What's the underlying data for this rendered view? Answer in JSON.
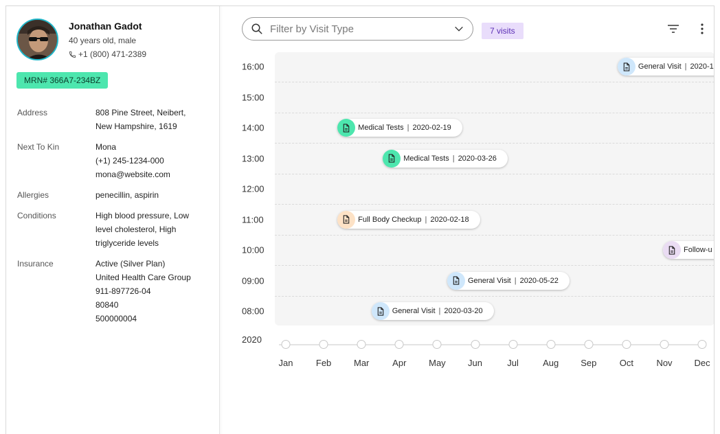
{
  "patient": {
    "name": "Jonathan Gadot",
    "age_sex": "40 years old, male",
    "phone": "+1 (800) 471-2389",
    "mrn": "MRN# 366A7-234BZ"
  },
  "details": [
    {
      "key": "Address",
      "lines": [
        "808 Pine Street, Neibert,",
        "New Hampshire, 1619"
      ]
    },
    {
      "key": "Next To Kin",
      "lines": [
        "Mona",
        "(+1) 245-1234-000",
        "mona@website.com"
      ]
    },
    {
      "key": "Allergies",
      "lines": [
        "penecillin, aspirin"
      ]
    },
    {
      "key": "Conditions",
      "lines": [
        "High blood pressure, Low",
        "level cholesterol, High",
        "triglyceride levels"
      ]
    },
    {
      "key": "Insurance",
      "lines": [
        "Active (Silver Plan)",
        "United Health Care Group",
        "911-897726-04",
        "80840",
        "500000004"
      ]
    }
  ],
  "toolbar": {
    "search_placeholder": "Filter by Visit Type",
    "visits_badge": "7 visits"
  },
  "colors": {
    "medical_tests": "#4de6ae",
    "full_body_checkup": "#fde2c6",
    "general_visit": "#cfe7fb",
    "follow_up": "#eadcf3"
  },
  "chart_data": {
    "type": "scatter",
    "year_label": "2020",
    "y_ticks": [
      "16:00",
      "15:00",
      "14:00",
      "13:00",
      "12:00",
      "11:00",
      "10:00",
      "09:00",
      "08:00"
    ],
    "x_ticks": [
      "Jan",
      "Feb",
      "Mar",
      "Apr",
      "May",
      "Jun",
      "Jul",
      "Aug",
      "Sep",
      "Oct",
      "Nov",
      "Dec"
    ],
    "ylim": [
      8,
      16
    ],
    "visits": [
      {
        "type": "General Visit",
        "date": "2020-1",
        "month": 10.0,
        "hour": 16.0,
        "label": "General Visit | 2020-1",
        "color_key": "general_visit"
      },
      {
        "type": "Medical Tests",
        "date": "2020-02-19",
        "month": 2.6,
        "hour": 14.0,
        "label": "Medical Tests | 2020-02-19",
        "color_key": "medical_tests"
      },
      {
        "type": "Medical Tests",
        "date": "2020-03-26",
        "month": 3.8,
        "hour": 13.0,
        "label": "Medical Tests | 2020-03-26",
        "color_key": "medical_tests"
      },
      {
        "type": "Full Body Checkup",
        "date": "2020-02-18",
        "month": 2.6,
        "hour": 11.0,
        "label": "Full Body Checkup | 2020-02-18",
        "color_key": "full_body_checkup"
      },
      {
        "type": "Follow-u",
        "date": "",
        "month": 11.2,
        "hour": 10.0,
        "label": "Follow-u",
        "color_key": "follow_up"
      },
      {
        "type": "General Visit",
        "date": "2020-05-22",
        "month": 5.5,
        "hour": 9.0,
        "label": "General Visit | 2020-05-22",
        "color_key": "general_visit"
      },
      {
        "type": "General Visit",
        "date": "2020-03-20",
        "month": 3.5,
        "hour": 8.0,
        "label": "General Visit | 2020-03-20",
        "color_key": "general_visit"
      }
    ]
  }
}
